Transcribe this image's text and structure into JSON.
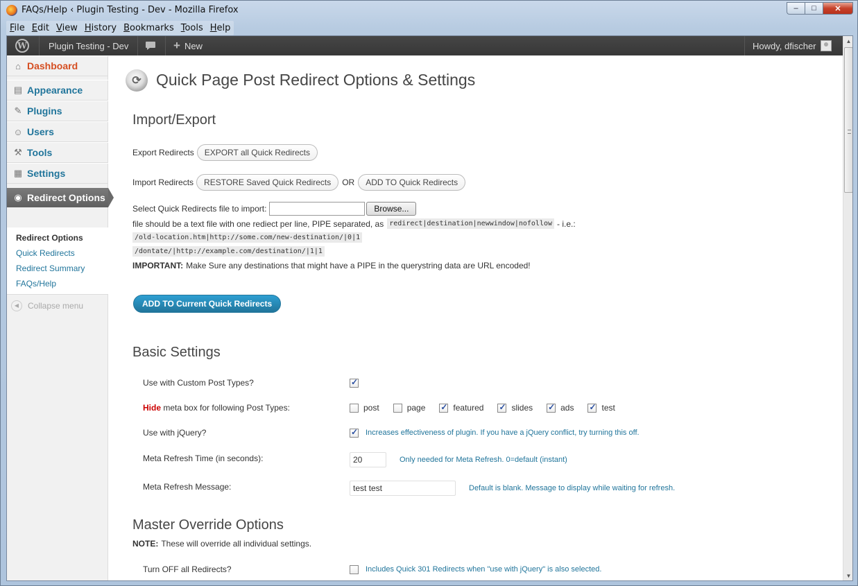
{
  "window": {
    "title": "FAQs/Help ‹ Plugin Testing - Dev - Mozilla Firefox",
    "min": "–",
    "max": "□",
    "close": "✕"
  },
  "menubar": [
    "File",
    "Edit",
    "View",
    "History",
    "Bookmarks",
    "Tools",
    "Help"
  ],
  "adminbar": {
    "site_name": "Plugin Testing - Dev",
    "comments_icon": "comment-bubble-icon",
    "new_plus": "+",
    "new_label": "New",
    "howdy": "Howdy, dfischer"
  },
  "sidebar": {
    "items": [
      {
        "label": "Dashboard",
        "icon": "⌂"
      },
      {
        "label": "Appearance",
        "icon": "▤"
      },
      {
        "label": "Plugins",
        "icon": "✎"
      },
      {
        "label": "Users",
        "icon": "☺"
      },
      {
        "label": "Tools",
        "icon": "⚒"
      },
      {
        "label": "Settings",
        "icon": "▦"
      },
      {
        "label": "Redirect Options",
        "icon": "◉"
      }
    ],
    "submenu": [
      "Redirect Options",
      "Quick Redirects",
      "Redirect Summary",
      "FAQs/Help"
    ],
    "collapse": "Collapse menu",
    "collapse_icon": "◀"
  },
  "page": {
    "icon": "⟳",
    "title": "Quick Page Post Redirect Options & Settings",
    "import_export": {
      "heading": "Import/Export",
      "export_label": "Export Redirects",
      "export_button": "EXPORT all Quick Redirects",
      "import_label": "Import Redirects",
      "restore_button": "RESTORE Saved Quick Redirects",
      "or": "OR",
      "add_button": "ADD TO Quick Redirects",
      "select_label": "Select Quick Redirects file to import:",
      "browse": "Browse...",
      "file_note_pre": "file should be a text file with one rediect per line, PIPE separated, as",
      "file_format": "redirect|destination|newwindow|nofollow",
      "file_note_post": "- i.e.:",
      "example1": "/old-location.htm|http://some.com/new-destination/|0|1",
      "example2": "/dontate/|http://example.com/destination/|1|1",
      "important_bold": "IMPORTANT:",
      "important_text": "Make Sure any destinations that might have a PIPE in the querystring data are URL encoded!",
      "add_current_button": "ADD TO Current Quick Redirects"
    },
    "basic": {
      "heading": "Basic Settings",
      "custom_post_types": {
        "label": "Use with Custom Post Types?",
        "checked": true
      },
      "hide_word": "Hide",
      "hide_rest": "meta box for following Post Types:",
      "post_types": [
        {
          "name": "post",
          "checked": false
        },
        {
          "name": "page",
          "checked": false
        },
        {
          "name": "featured",
          "checked": true
        },
        {
          "name": "slides",
          "checked": true
        },
        {
          "name": "ads",
          "checked": true
        },
        {
          "name": "test",
          "checked": true
        }
      ],
      "jquery": {
        "label": "Use with jQuery?",
        "checked": true,
        "desc": "Increases effectiveness of plugin. If you have a jQuery conflict, try turning this off."
      },
      "meta_refresh_time": {
        "label": "Meta Refresh Time (in seconds):",
        "value": "20",
        "desc": "Only needed for Meta Refresh. 0=default (instant)"
      },
      "meta_refresh_msg": {
        "label": "Meta Refresh Message:",
        "value": "test test",
        "desc": "Default is blank. Message to display while waiting for refresh."
      }
    },
    "master": {
      "heading": "Master Override Options",
      "note_bold": "NOTE:",
      "note_text": "These will override all individual settings.",
      "turn_off": {
        "label": "Turn OFF all Redirects?",
        "checked": false,
        "desc": "Includes Quick 301 Redirects when \"use with jQuery\" is also selected."
      }
    }
  },
  "scrollbar": {
    "up": "▲",
    "down": "▼"
  }
}
